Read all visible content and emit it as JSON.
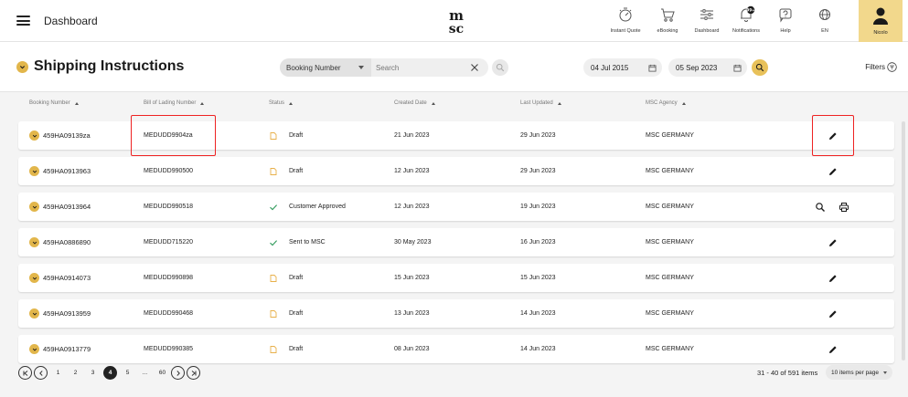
{
  "header": {
    "title": "Dashboard",
    "nav": [
      {
        "label": "Instant Quote",
        "icon": "instant-quote-icon"
      },
      {
        "label": "eBooking",
        "icon": "cart-icon"
      },
      {
        "label": "Dashboard",
        "icon": "sliders-icon"
      },
      {
        "label": "Notifications",
        "icon": "bell-icon",
        "badge": "99+"
      },
      {
        "label": "Help",
        "icon": "help-icon"
      },
      {
        "label": "EN",
        "icon": "globe-icon"
      }
    ],
    "user": {
      "name": "Nicolo"
    },
    "logo_lines": [
      "m",
      "sc"
    ]
  },
  "page": {
    "title": "Shipping Instructions"
  },
  "search": {
    "type_value": "Booking Number",
    "placeholder": "Search"
  },
  "dates": {
    "from": "04 Jul 2015",
    "to": "05 Sep 2023"
  },
  "filters": {
    "label": "Filters"
  },
  "table": {
    "headers": [
      "Booking Number",
      "Bill of Lading Number",
      "Status",
      "Created Date",
      "Last Updated",
      "MSC Agency"
    ],
    "rows": [
      {
        "booking": "459HA09139za",
        "bol": "MEDUDD9904za",
        "status": "Draft",
        "status_icon": "draft-icon",
        "created": "21 Jun 2023",
        "updated": "29 Jun 2023",
        "agency": "MSC GERMANY",
        "actions": [
          "edit"
        ]
      },
      {
        "booking": "459HA0913963",
        "bol": "MEDUDD990500",
        "status": "Draft",
        "status_icon": "draft-icon",
        "created": "12 Jun 2023",
        "updated": "29 Jun 2023",
        "agency": "MSC GERMANY",
        "actions": [
          "edit"
        ]
      },
      {
        "booking": "459HA0913964",
        "bol": "MEDUDD990518",
        "status": "Customer Approved",
        "status_icon": "check-icon",
        "created": "12 Jun 2023",
        "updated": "19 Jun 2023",
        "agency": "MSC GERMANY",
        "actions": [
          "view",
          "print"
        ]
      },
      {
        "booking": "459HA0886890",
        "bol": "MEDUDD715220",
        "status": "Sent to MSC",
        "status_icon": "check-icon",
        "created": "30 May 2023",
        "updated": "16 Jun 2023",
        "agency": "MSC GERMANY",
        "actions": [
          "edit"
        ]
      },
      {
        "booking": "459HA0914073",
        "bol": "MEDUDD990898",
        "status": "Draft",
        "status_icon": "draft-icon",
        "created": "15 Jun 2023",
        "updated": "15 Jun 2023",
        "agency": "MSC GERMANY",
        "actions": [
          "edit"
        ]
      },
      {
        "booking": "459HA0913959",
        "bol": "MEDUDD990468",
        "status": "Draft",
        "status_icon": "draft-icon",
        "created": "13 Jun 2023",
        "updated": "14 Jun 2023",
        "agency": "MSC GERMANY",
        "actions": [
          "edit"
        ]
      },
      {
        "booking": "459HA0913779",
        "bol": "MEDUDD990385",
        "status": "Draft",
        "status_icon": "draft-icon",
        "created": "08 Jun 2023",
        "updated": "14 Jun 2023",
        "agency": "MSC GERMANY",
        "actions": [
          "edit"
        ]
      }
    ]
  },
  "pagination": {
    "pages": [
      "1",
      "2",
      "3",
      "4",
      "5",
      "...",
      "60"
    ],
    "current": "4",
    "items_count": "31 - 40 of 591 items",
    "per_page": "10 items per page"
  },
  "colors": {
    "accent": "#e2b64b",
    "user_bg": "#f2d88c",
    "highlight": "#e22222",
    "draft": "#e8b04a",
    "check": "#2e9a5a"
  }
}
